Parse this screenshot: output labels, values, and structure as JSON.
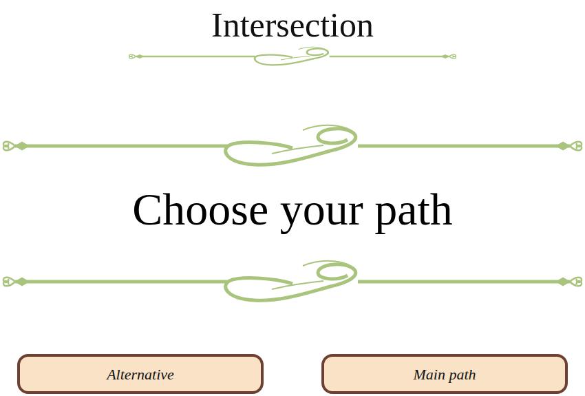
{
  "title": "Intersection",
  "heading": "Choose your path",
  "buttons": [
    {
      "label": "Alternative"
    },
    {
      "label": "Main path"
    }
  ]
}
